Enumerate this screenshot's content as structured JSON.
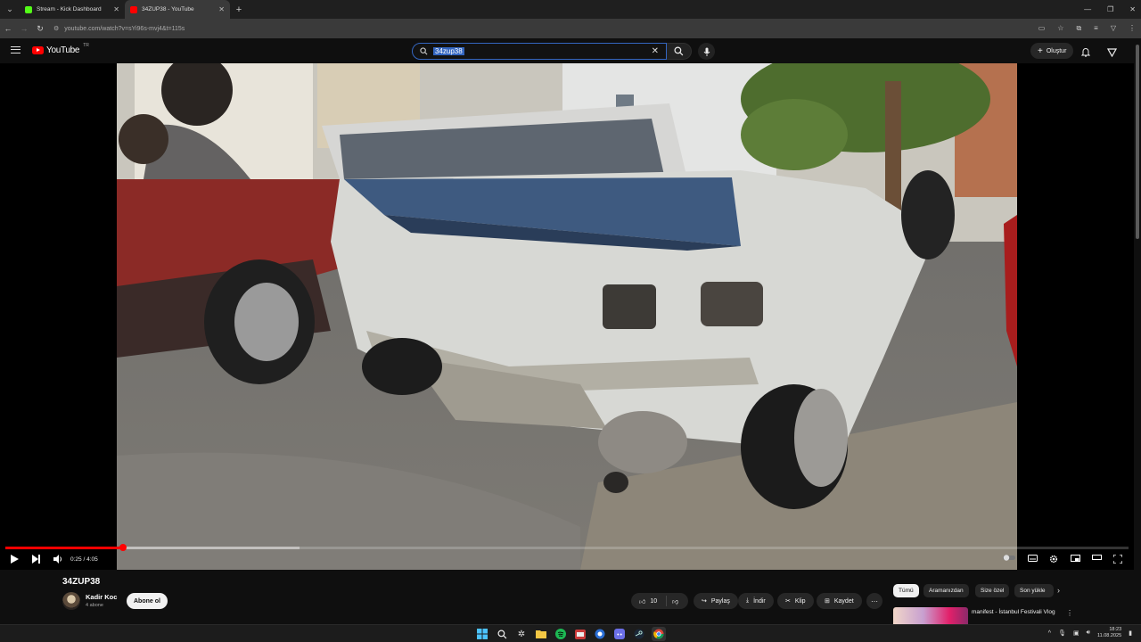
{
  "browser": {
    "tabs": [
      {
        "title": "Stream - Kick Dashboard",
        "favicon_color": "#53fc18",
        "active": false
      },
      {
        "title": "34ZUP38 - YouTube",
        "favicon_color": "#ff0000",
        "active": true
      }
    ],
    "url": "youtube.com/watch?v=sYi96s-mvj4&t=115s"
  },
  "youtube": {
    "logo_text": "YouTube",
    "logo_country": "TR",
    "search_query": "34zup38",
    "create_label": "Oluştur"
  },
  "player": {
    "time_text": "0:25 / 4:05",
    "progress_fraction": 0.105,
    "buffered_fraction": 0.262
  },
  "video_info": {
    "title": "34ZUP38",
    "channel_name": "Kadir Koc",
    "subscribers": "4 abone",
    "subscribe_label": "Abone ol",
    "like_count": "10",
    "share_label": "Paylaş",
    "download_label": "İndir",
    "clip_label": "Klip",
    "save_label": "Kaydet"
  },
  "recommendations": {
    "chips": [
      "Tümü",
      "Aramanızdan",
      "Size özel",
      "Son yükle"
    ],
    "first_item_title": "manifest - İstanbul Festivali Vlog"
  },
  "taskbar": {
    "time": "18:23",
    "date": "11.08.2025"
  }
}
